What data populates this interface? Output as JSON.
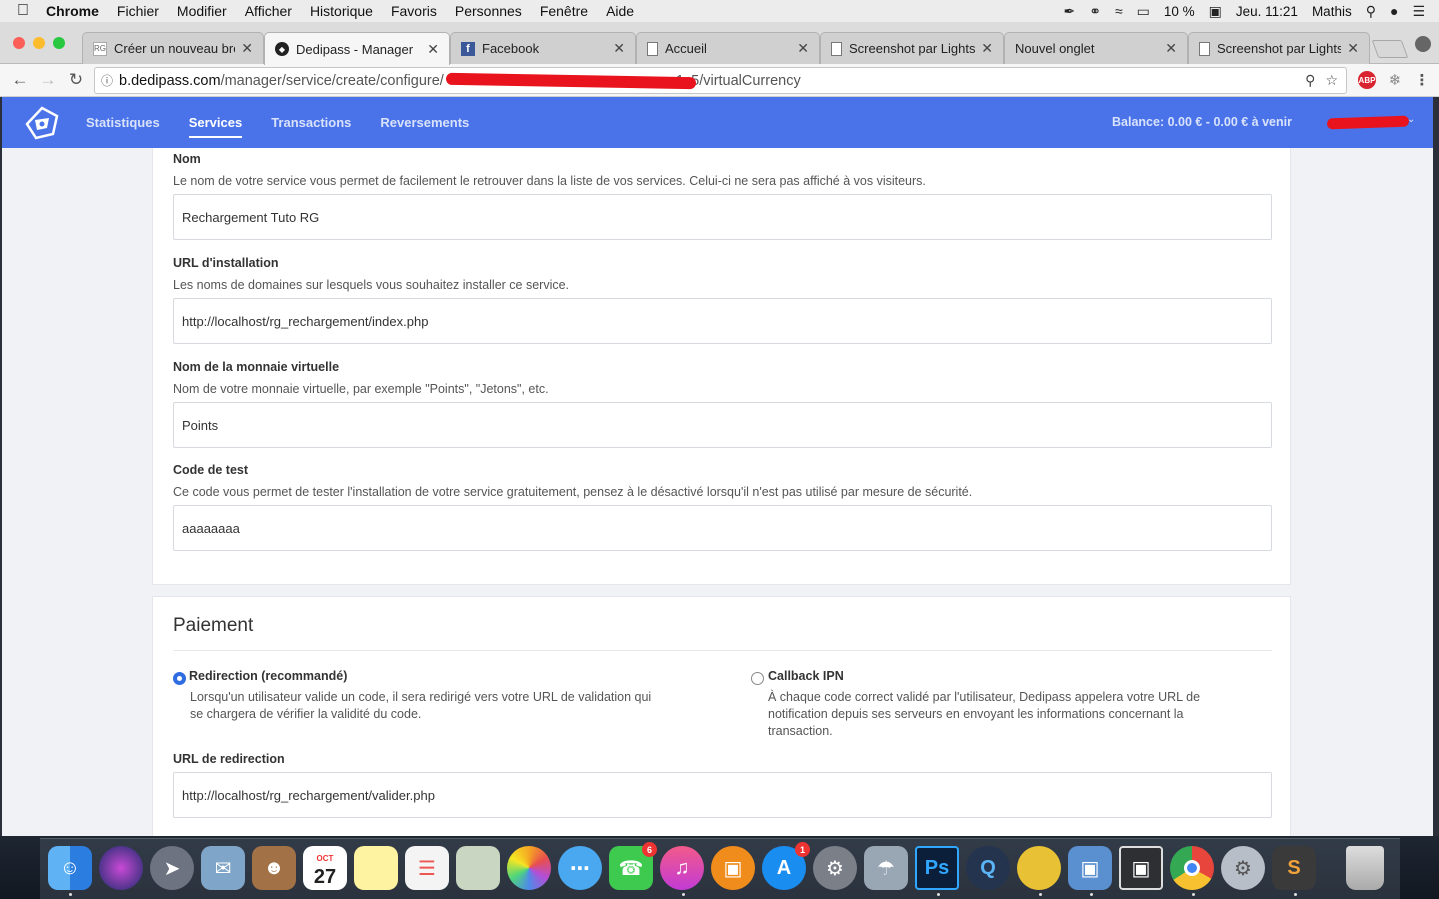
{
  "menubar": {
    "app": "Chrome",
    "items": [
      "Fichier",
      "Modifier",
      "Afficher",
      "Historique",
      "Favoris",
      "Personnes",
      "Fenêtre",
      "Aide"
    ],
    "battery": "10 %",
    "clock": "Jeu. 11:21",
    "user": "Mathis"
  },
  "tabs": [
    {
      "title": "Créer un nouveau brou",
      "active": false
    },
    {
      "title": "Dedipass - Manager",
      "active": true
    },
    {
      "title": "Facebook",
      "active": false
    },
    {
      "title": "Accueil",
      "active": false
    },
    {
      "title": "Screenshot par Lightsh",
      "active": false
    },
    {
      "title": "Nouvel onglet",
      "active": false
    },
    {
      "title": "Screenshot par Lightsh",
      "active": false
    }
  ],
  "address": {
    "host": "b.dedipass.com",
    "path_start": "/manager/service/create/configure/",
    "path_end": "1c5/virtualCurrency"
  },
  "extensions": {
    "abp": "ABP"
  },
  "appnav": {
    "links": [
      "Statistiques",
      "Services",
      "Transactions",
      "Reversements"
    ],
    "balance": "Balance: 0.00 € - 0.00 € à venir"
  },
  "form": {
    "name": {
      "label": "Nom",
      "help": "Le nom de votre service vous permet de facilement le retrouver dans la liste de vos services. Celui-ci ne sera pas affiché à vos visiteurs.",
      "value": "Rechargement Tuto RG"
    },
    "url": {
      "label": "URL d'installation",
      "help": "Les noms de domaines sur lesquels vous souhaitez installer ce service.",
      "value": "http://localhost/rg_rechargement/index.php"
    },
    "currency": {
      "label": "Nom de la monnaie virtuelle",
      "help": "Nom de votre monnaie virtuelle, par exemple \"Points\", \"Jetons\", etc.",
      "value": "Points"
    },
    "testcode": {
      "label": "Code de test",
      "help": "Ce code vous permet de tester l'installation de votre service gratuitement, pensez à le désactivé lorsqu'il n'est pas utilisé par mesure de sécurité.",
      "value": "aaaaaaaa"
    }
  },
  "payment": {
    "title": "Paiement",
    "redirect": {
      "label": "Redirection (recommandé)",
      "desc_l1": "Lorsqu'un utilisateur valide un code, il sera redirigé vers votre URL de validation qui",
      "desc_l2": "se chargera de vérifier la validité du code.",
      "selected": true
    },
    "ipn": {
      "label": "Callback IPN",
      "desc_l1": "À chaque code correct validé par l'utilisateur, Dedipass appelera votre URL de",
      "desc_l2": "notification depuis ses serveurs en envoyant les informations concernant la",
      "desc_l3": "transaction.",
      "selected": false
    },
    "redirect_url": {
      "label": "URL de redirection",
      "value": "http://localhost/rg_rechargement/valider.php"
    }
  },
  "dock": {
    "calendar_month": "OCT",
    "calendar_day": "27",
    "facetime_badge": "6",
    "appstore_badge": "1",
    "photoshop": "Ps"
  }
}
